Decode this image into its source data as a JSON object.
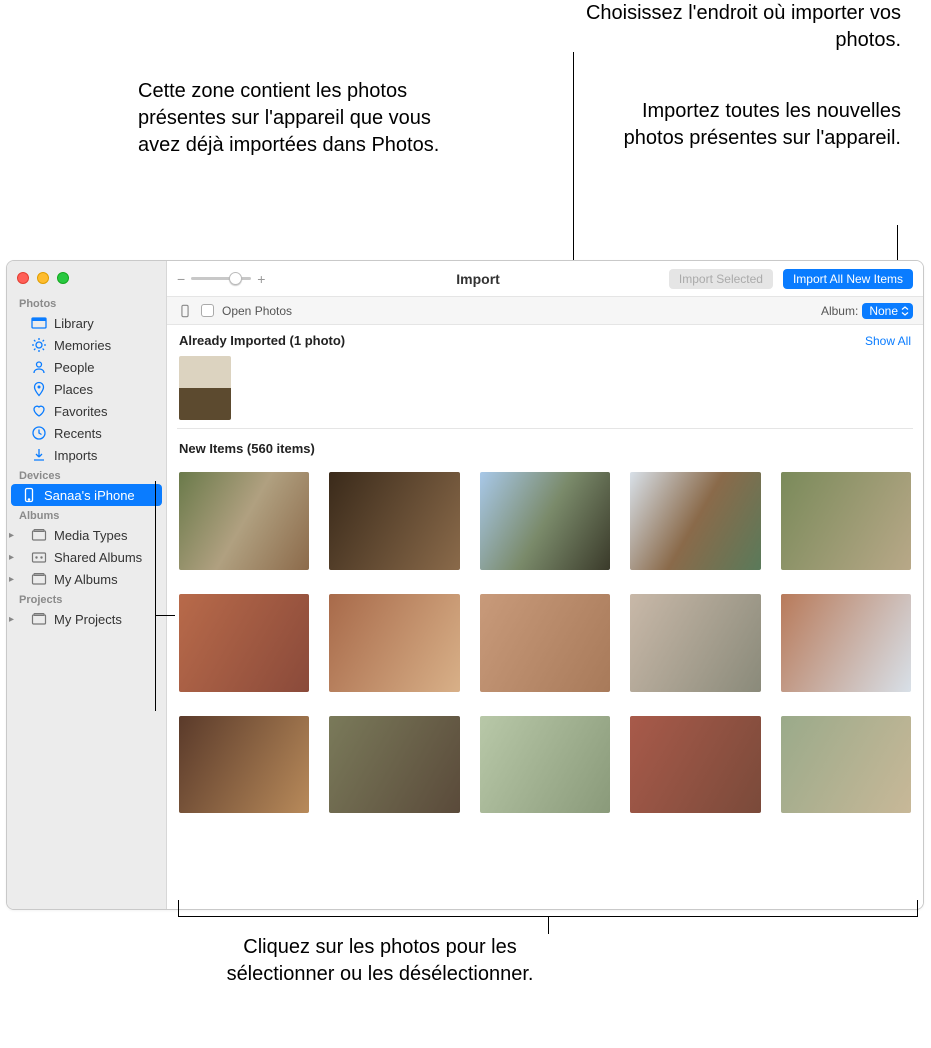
{
  "callouts": {
    "top_left": "Cette zone contient les photos présentes sur l'appareil que vous avez déjà importées dans Photos.",
    "top_right_1": "Choisissez l'endroit où importer vos photos.",
    "top_right_2": "Importez toutes les nouvelles photos présentes sur l'appareil.",
    "bottom": "Cliquez sur les photos pour les sélectionner ou les désélectionner."
  },
  "toolbar": {
    "title": "Import",
    "import_selected": "Import Selected",
    "import_all": "Import All New Items",
    "zoom_minus": "−",
    "zoom_plus": "+"
  },
  "subbar": {
    "open_photos": "Open Photos",
    "album_label": "Album:",
    "album_value": "None"
  },
  "sections": {
    "already_imported": "Already Imported (1 photo)",
    "show_all": "Show All",
    "new_items": "New Items (560 items)"
  },
  "sidebar": {
    "photos_header": "Photos",
    "library": "Library",
    "memories": "Memories",
    "people": "People",
    "places": "Places",
    "favorites": "Favorites",
    "recents": "Recents",
    "imports": "Imports",
    "devices_header": "Devices",
    "device_name": "Sanaa's iPhone",
    "albums_header": "Albums",
    "media_types": "Media Types",
    "shared_albums": "Shared Albums",
    "my_albums": "My Albums",
    "projects_header": "Projects",
    "my_projects": "My Projects"
  }
}
